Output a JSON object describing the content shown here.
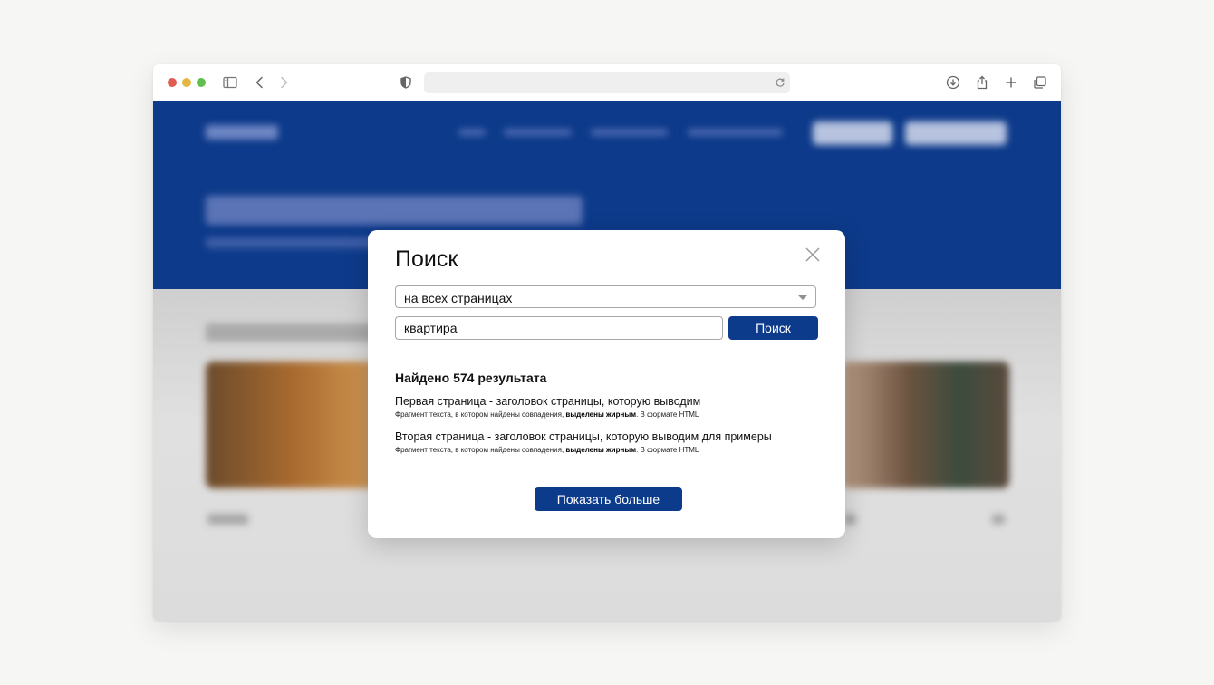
{
  "colors": {
    "brand_blue": "#0c3b8c",
    "hero_blue": "#0d3a8a",
    "backdrop": "#f6f6f4"
  },
  "browser": {
    "icons": [
      "sidebar-icon",
      "back-icon",
      "forward-icon",
      "shield-icon",
      "reload-icon",
      "download-icon",
      "share-icon",
      "new-tab-icon",
      "tabs-overview-icon"
    ]
  },
  "modal": {
    "title": "Поиск",
    "scope_select": {
      "selected": "на всех страницах"
    },
    "query_input": {
      "value": "квартира"
    },
    "search_button": "Поиск",
    "found_text": "Найдено 574 результата",
    "results": [
      {
        "title": "Первая страница -  заголовок страницы, которую выводим",
        "snippet_before": "Фрагмент текста, в котором найдены совпадения, ",
        "snippet_bold": "выделены жирным",
        "snippet_after": ". В формате HTML"
      },
      {
        "title": "Вторая страница -  заголовок страницы, которую выводим для примеры",
        "snippet_before": "Фрагмент текста, в котором найдены совпадения, ",
        "snippet_bold": "выделены жирным",
        "snippet_after": ". В формате HTML"
      }
    ],
    "show_more_button": "Показать больше"
  }
}
